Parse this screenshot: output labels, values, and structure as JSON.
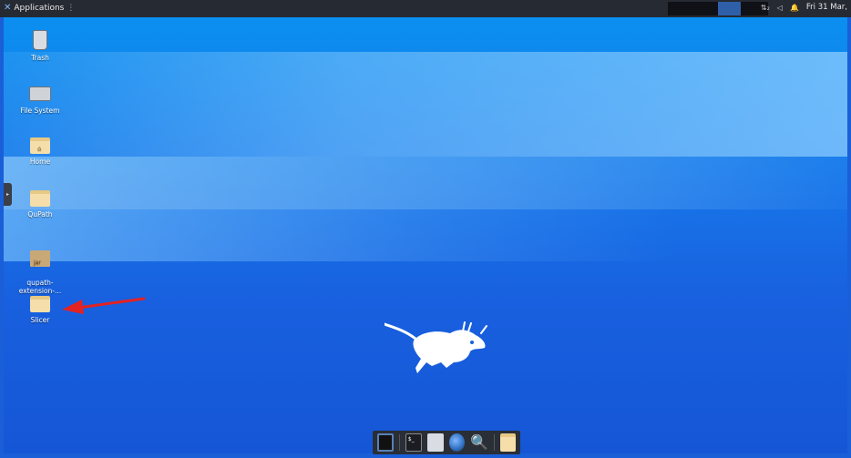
{
  "topbar": {
    "apps_label": "Applications",
    "apps_menu": "⋮",
    "tray_network": "⇅₂",
    "tray_sound": "◁",
    "tray_notify": "🔔",
    "clock": "Fri 31 Mar,"
  },
  "desktop_icons": [
    {
      "label": "Trash",
      "icon": "trash-icon"
    },
    {
      "label": "File System",
      "icon": "drive-icon"
    },
    {
      "label": "Home",
      "icon": "home-folder-icon"
    },
    {
      "label": "QuPath",
      "icon": "folder-icon"
    },
    {
      "label": "qupath-\nextension-...",
      "icon": "archive-icon"
    },
    {
      "label": "Slicer",
      "icon": "folder-icon"
    }
  ],
  "archive_tag": "jar",
  "dock": {
    "items": [
      "show-desktop",
      "terminal",
      "home-folder",
      "web-browser",
      "search",
      "file-manager"
    ],
    "terminal_text": "$_"
  },
  "colors": {
    "topbar": "#262a33",
    "arrow": "#e32222",
    "desktop": "#1778ea"
  }
}
